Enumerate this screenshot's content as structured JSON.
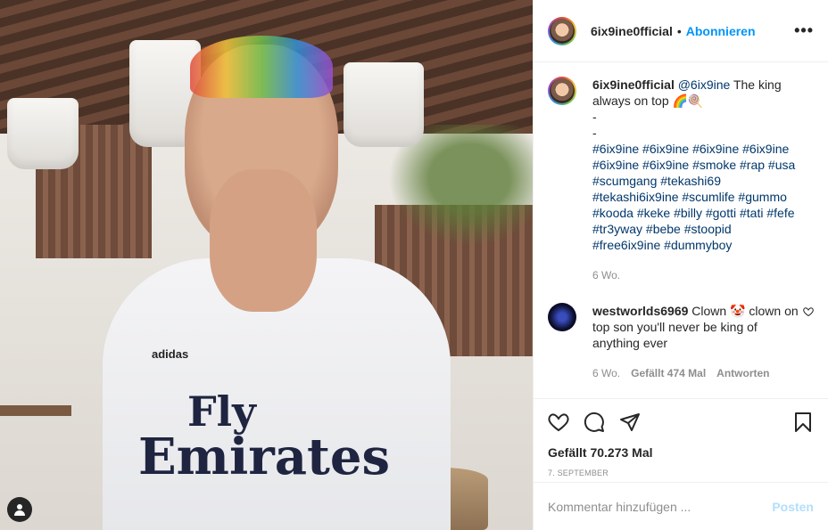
{
  "post": {
    "username": "6ix9ine0fficial",
    "follow_separator": "•",
    "follow_label": "Abonnieren",
    "more_label": "•••"
  },
  "caption": {
    "username": "6ix9ine0fficial",
    "mention": "@6ix9ine",
    "text": "The king always on top 🌈🍭",
    "dash1": "-",
    "dash2": "-",
    "hashtags": "#6ix9ine #6ix9ine #6ix9ine #6ix9ine #6ix9ine #6ix9ine #smoke #rap #usa #scumgang #tekashi69 #tekashi6ix9ine #scumlife #gummo #kooda #keke #billy #gotti #tati #fefe #tr3yway #bebe #stoopid #free6ix9ine #dummyboy",
    "time": "6 Wo."
  },
  "comment": {
    "username": "westworlds6969",
    "text": "Clown 🤡 clown on top son you'll never be king of anything ever",
    "time": "6 Wo.",
    "likes": "Gefällt 474 Mal",
    "reply": "Antworten"
  },
  "footer": {
    "likes": "Gefällt 70.273 Mal",
    "date": "7. September",
    "placeholder": "Kommentar hinzufügen ...",
    "post_label": "Posten"
  },
  "photo": {
    "jersey_line1": "Fly",
    "jersey_line2": "Emirates",
    "jersey_brand": "adidas"
  },
  "icons": [
    "user-tag-icon",
    "heart-icon",
    "comment-icon",
    "share-icon",
    "bookmark-icon",
    "more-icon"
  ],
  "colors": {
    "link": "#00376b",
    "follow": "#0095f6",
    "post_disabled": "#b2dffc",
    "muted": "#8e8e8e"
  }
}
